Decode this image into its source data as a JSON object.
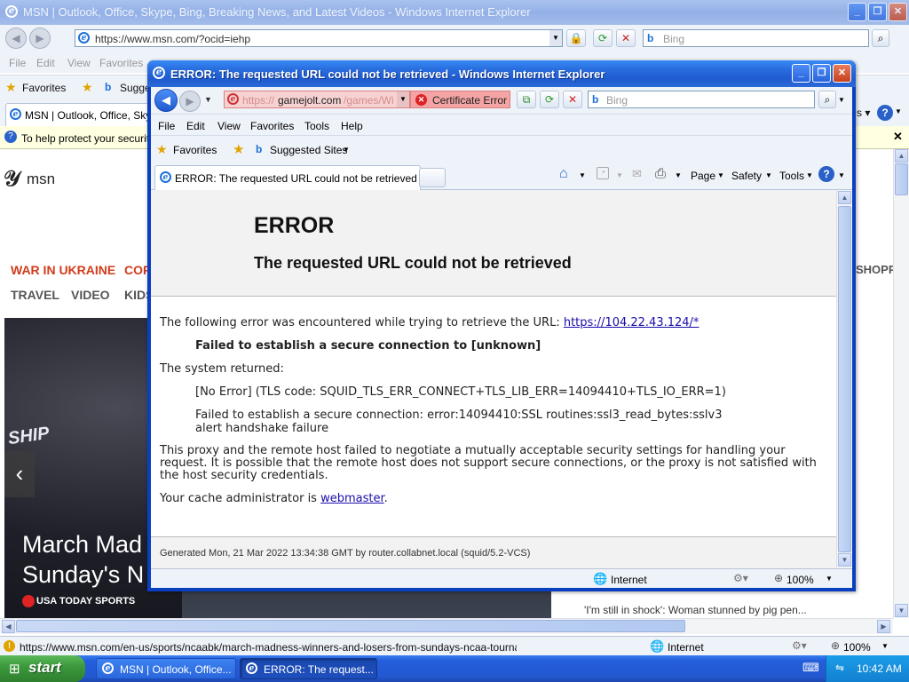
{
  "bg_window": {
    "title": "MSN | Outlook, Office, Skype, Bing, Breaking News, and Latest Videos - Windows Internet Explorer",
    "url": "https://www.msn.com/?ocid=iehp",
    "search_placeholder": "Bing",
    "menu": [
      "File",
      "Edit",
      "View",
      "Favorites"
    ],
    "favorites_label": "Favorites",
    "suggested_label": "Suggest",
    "tab_label": "MSN | Outlook, Office, Skype",
    "infobar_text": "To help protect your security,",
    "logo_text": "msn",
    "nav_row1": [
      "WAR IN UKRAINE",
      "COR",
      "SHOPPI"
    ],
    "nav_row2": [
      "TRAVEL",
      "VIDEO",
      "KIDS"
    ],
    "hero_sign": "SHIP",
    "hero_headline_1": "March Mad",
    "hero_headline_2": "Sunday's N",
    "hero_source": "USA TODAY SPORTS",
    "side_story": "'I'm still in shock': Woman stunned by pig pen...",
    "status_url": "https://www.msn.com/en-us/sports/ncaabk/march-madness-winners-and-losers-from-sundays-ncaa-tournament-gan",
    "status_zone": "Internet",
    "status_zoom": "100%"
  },
  "fg_window": {
    "title": "ERROR: The requested URL could not be retrieved - Windows Internet Explorer",
    "url_prefix": "https://",
    "url_host": "gamejolt.com",
    "url_rest": "/games/Windo",
    "cert_error": "Certificate Error",
    "search_placeholder": "Bing",
    "menu": [
      "File",
      "Edit",
      "View",
      "Favorites",
      "Tools",
      "Help"
    ],
    "favorites_label": "Favorites",
    "suggested_label": "Suggested Sites",
    "tab_label": "ERROR: The requested URL could not be retrieved",
    "cmd": {
      "page": "Page",
      "safety": "Safety",
      "tools": "Tools"
    },
    "status_zone": "Internet",
    "status_zoom": "100%"
  },
  "error_page": {
    "heading": "ERROR",
    "subheading": "The requested URL could not be retrieved",
    "p1": "The following error was encountered while trying to retrieve the URL:",
    "p1_link": "https://104.22.43.124/*",
    "p2": "Failed to establish a secure connection to [unknown]",
    "p3": "The system returned:",
    "p4": "[No Error] (TLS code: SQUID_TLS_ERR_CONNECT+TLS_LIB_ERR=14094410+TLS_IO_ERR=1)",
    "p5": "Failed to establish a secure connection: error:14094410:SSL routines:ssl3_read_bytes:sslv3 alert handshake failure",
    "p6": "This proxy and the remote host failed to negotiate a mutually acceptable security settings for handling your request. It is possible that the remote host does not support secure connections, or the proxy is not satisfied with the host security credentials.",
    "p7_prefix": "Your cache administrator is",
    "p7_link": "webmaster",
    "p7_suffix": ".",
    "footer": "Generated Mon, 21 Mar 2022 13:34:38 GMT by router.collabnet.local (squid/5.2-VCS)"
  },
  "taskbar": {
    "start": "start",
    "tasks": [
      "MSN | Outlook, Office...",
      "ERROR: The request..."
    ],
    "clock": "10:42 AM"
  },
  "colors": {
    "titlebar": "#2a6fe0",
    "taskbar": "#245edb",
    "start": "#3c9a3c",
    "cert_error_bg": "#f4a4a4"
  }
}
